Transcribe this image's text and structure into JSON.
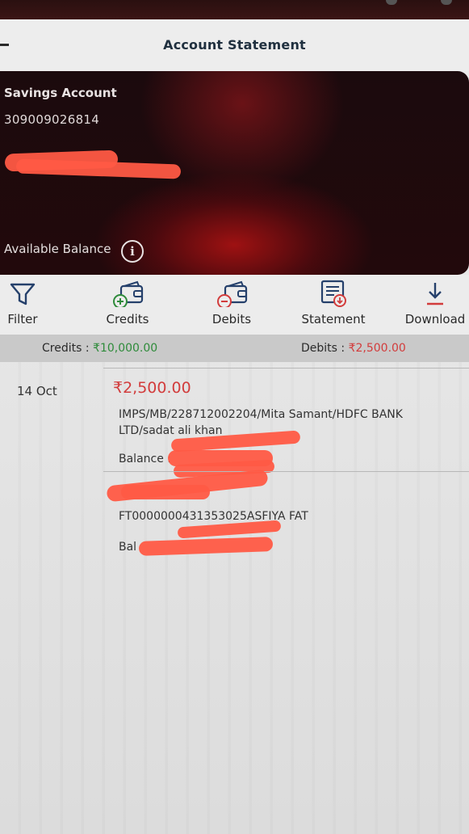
{
  "header": {
    "title": "Account Statement"
  },
  "account": {
    "type": "Savings Account",
    "number": "309009026814",
    "available_balance_label": "Available Balance"
  },
  "actions": [
    {
      "label": "Filter",
      "icon": "filter-icon"
    },
    {
      "label": "Credits",
      "icon": "wallet-plus-icon"
    },
    {
      "label": "Debits",
      "icon": "wallet-minus-icon"
    },
    {
      "label": "Statement",
      "icon": "statement-icon"
    },
    {
      "label": "Download",
      "icon": "download-icon"
    }
  ],
  "summary": {
    "credits_label": "Credits :",
    "credits_value": "₹10,000.00",
    "debits_label": "Debits :",
    "debits_value": "₹2,500.00"
  },
  "transactions": [
    {
      "date": "14 Oct",
      "amount": "₹2,500.00",
      "description": "IMPS/MB/228712002204/Mita Samant/HDFC BANK LTD/sadat ali khan",
      "balance_label": "Balance :"
    },
    {
      "description": "FT0000000431353025ASFIYA FAT",
      "balance_label": "Bal"
    }
  ],
  "colors": {
    "credit": "#2e8b3a",
    "debit": "#d23c3c",
    "card_accent": "#c8141e",
    "icon_blue": "#25406b"
  }
}
